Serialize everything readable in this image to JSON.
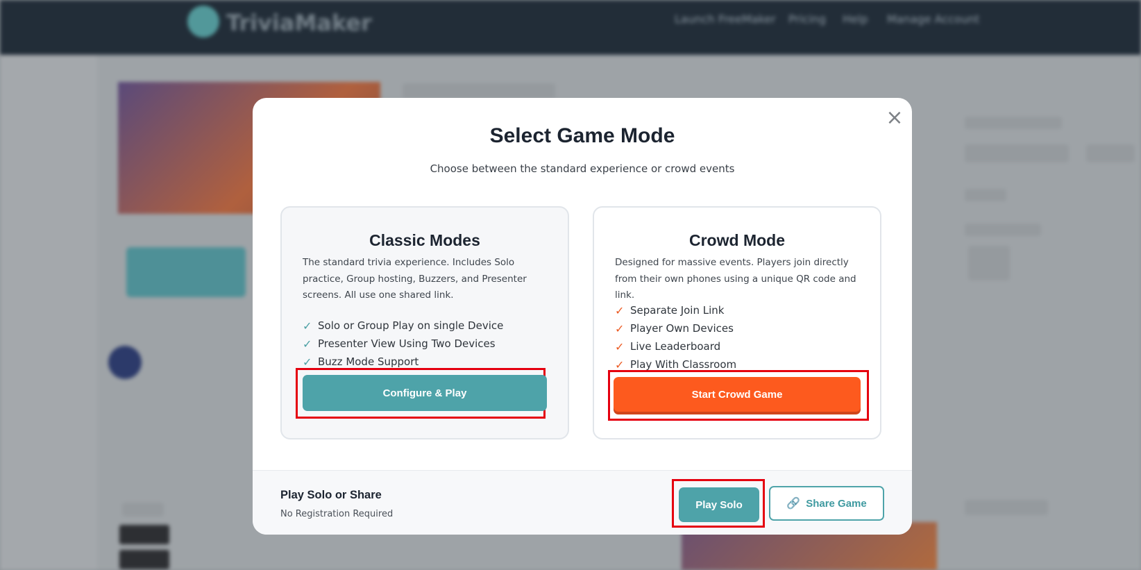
{
  "background": {
    "app_logo": "TriviaMaker",
    "nav_items": [
      "Launch FreeMaker",
      "Pricing",
      "Help",
      "Manage Account"
    ]
  },
  "modal": {
    "title": "Select Game Mode",
    "subtitle": "Choose between the standard experience or crowd events",
    "close_icon": "×",
    "classic": {
      "name": "Classic Modes",
      "description": "The standard trivia experience. Includes Solo practice, Group hosting, Buzzers, and Presenter screens. All use one shared link.",
      "features": [
        "Solo or Group Play on single Device",
        "Presenter View Using Two Devices",
        "Buzz Mode Support"
      ],
      "button_label": "Configure & Play"
    },
    "crowd": {
      "name": "Crowd Mode",
      "description": "Designed for massive events. Players join directly from their own phones using a unique QR code and link.",
      "features": [
        "Separate Join Link",
        "Player Own Devices",
        "Live Leaderboard",
        "Play With Classroom"
      ],
      "button_label": "Start Crowd Game"
    },
    "footer": {
      "title": "Play Solo or Share",
      "subtitle": "No Registration Required",
      "play_solo_label": "Play Solo",
      "share_label": "Share Game",
      "share_icon": "link-icon"
    },
    "check_glyph": "✓"
  },
  "colors": {
    "teal": "#4ea3a9",
    "orange": "#fd5a1e",
    "highlight": "#e5000f"
  }
}
